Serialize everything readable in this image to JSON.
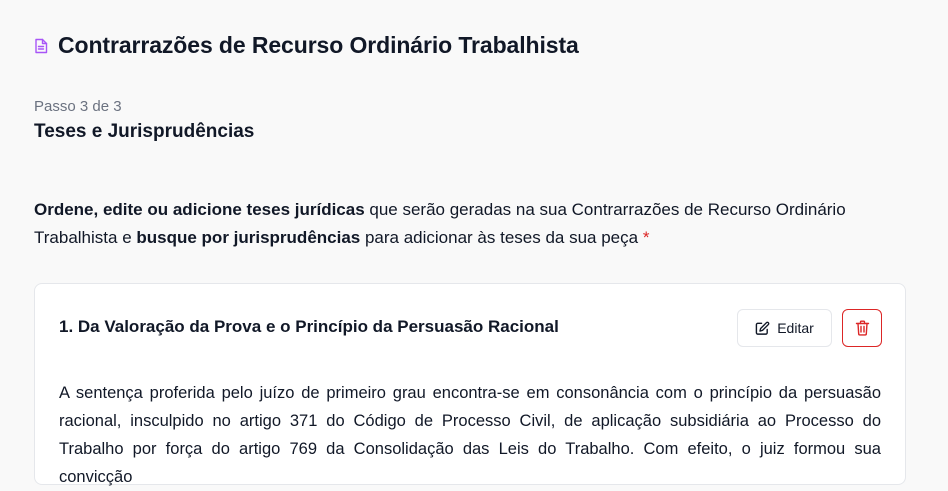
{
  "header": {
    "title": "Contrarrazões de Recurso Ordinário Trabalhista",
    "icon": "document-icon",
    "icon_color": "#a855f7"
  },
  "step": {
    "label": "Passo 3 de 3",
    "title": "Teses e Jurisprudências"
  },
  "instructions": {
    "bold_1": "Ordene, edite ou adicione teses jurídicas",
    "text_1": " que serão geradas na sua Contrarrazões de Recurso Ordinário Trabalhista e ",
    "bold_2": "busque por jurisprudências",
    "text_2": " para adicionar às teses da sua peça ",
    "required_marker": "*",
    "required_color": "#dc2626"
  },
  "thesis": {
    "title": "1. Da Valoração da Prova e o Princípio da Persuasão Racional",
    "edit_label": "Editar",
    "edit_icon": "pencil-square-icon",
    "delete_icon": "trash-icon",
    "delete_color": "#dc2626",
    "body": "A sentença proferida pelo juízo de primeiro grau encontra-se em consonância com o princípio da persuasão racional, insculpido no artigo 371 do Código de Processo Civil, de aplicação subsidiária ao Processo do Trabalho por força do artigo 769 da Consolidação das Leis do Trabalho. Com efeito, o juiz formou sua convicção"
  }
}
